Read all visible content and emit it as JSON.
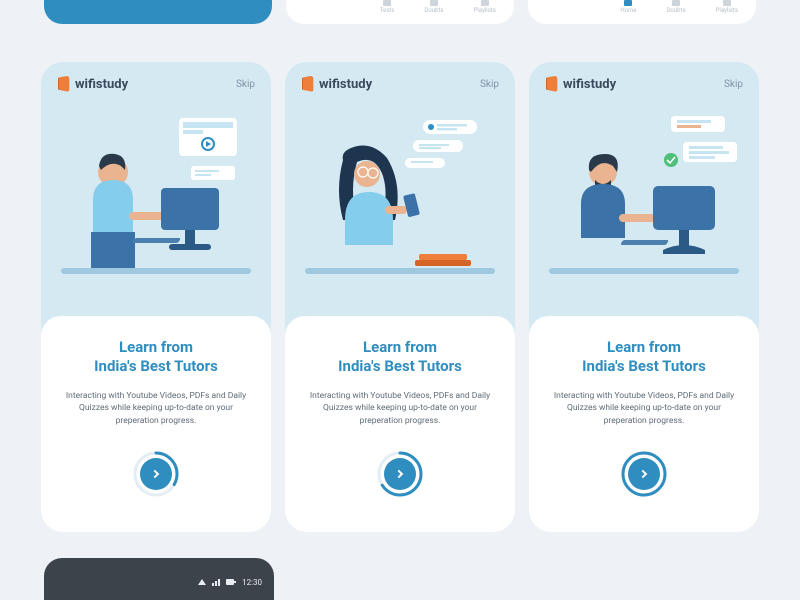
{
  "brand": {
    "name": "wifistudy"
  },
  "skip_label": "Skip",
  "colors": {
    "accent": "#2f8dbf",
    "orange": "#ee7e3a",
    "panel": "#d5e9f3",
    "text_dark": "#3a4a5c",
    "text_body": "#5f6b77"
  },
  "top_nav": {
    "items": [
      "Home",
      "Tests",
      "Doubts",
      "Playlists"
    ]
  },
  "screens": [
    {
      "title_line1": "Learn from",
      "title_line2": "India's Best Tutors",
      "description": "Interacting with Youtube Videos, PDFs and Daily Quizzes while keeping up-to-date on your preperation progress.",
      "progress_fraction": 0.33
    },
    {
      "title_line1": "Learn from",
      "title_line2": "India's Best Tutors",
      "description": "Interacting with Youtube Videos, PDFs and Daily Quizzes while keeping up-to-date on your preperation progress.",
      "progress_fraction": 0.66
    },
    {
      "title_line1": "Learn from",
      "title_line2": "India's Best Tutors",
      "description": "Interacting with Youtube Videos, PDFs and Daily Quizzes while keeping up-to-date on your preperation progress.",
      "progress_fraction": 1.0
    }
  ],
  "status_bar": {
    "time": "12:30"
  }
}
